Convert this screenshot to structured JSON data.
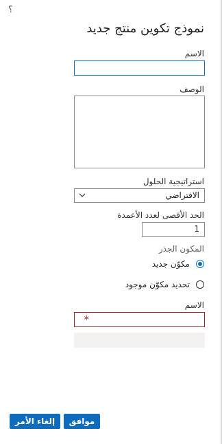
{
  "panel": {
    "help_icon": "question-icon",
    "title": "نموذج تكوين منتج جديد"
  },
  "form": {
    "name_label": "الاسم",
    "name_value": "",
    "description_label": "الوصف",
    "description_value": "",
    "strategy_label": "استراتيجية الحلول",
    "strategy_value": "الافتراضي",
    "max_columns_label": "الحد الأقصى لعدد الأعمدة",
    "max_columns_value": "1",
    "root_component_label": "المكون الجذر",
    "radio_new_label": "مكوّن جديد",
    "radio_existing_label": "تحديد مكوّن موجود",
    "radio_selected": "new",
    "root_name_label": "الاسم",
    "required_marker": "*"
  },
  "footer": {
    "ok_label": "موافق",
    "cancel_label": "إلغاء الأمر"
  },
  "colors": {
    "accent": "#0f6cbd",
    "error": "#a4262c"
  }
}
